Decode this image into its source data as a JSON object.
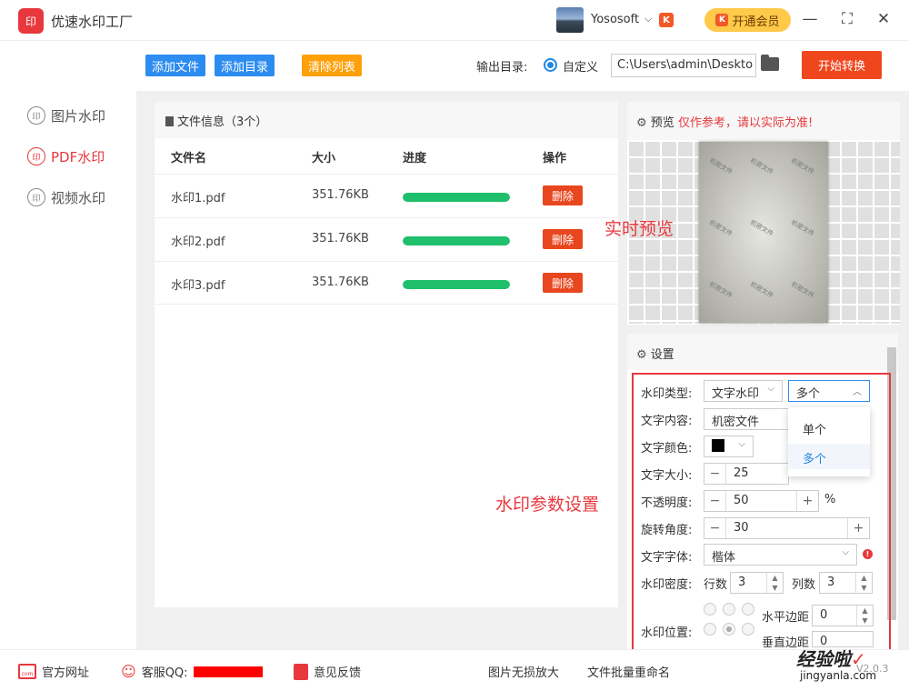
{
  "app": {
    "logo_text": "印",
    "title": "优速水印工厂"
  },
  "user": {
    "name": "Yososoft",
    "chevron": "⌵",
    "badge": "K"
  },
  "vip": {
    "label": "开通会员",
    "icon": "K"
  },
  "window": {
    "minimize": "—",
    "maximize": "⛶",
    "close": "✕"
  },
  "sidebar": {
    "items": [
      {
        "icon": "印",
        "label": "图片水印"
      },
      {
        "icon": "印",
        "label": "PDF水印"
      },
      {
        "icon": "印",
        "label": "视频水印"
      }
    ]
  },
  "toolbar": {
    "add_file": "添加文件",
    "add_dir": "添加目录",
    "clear": "清除列表",
    "output_label": "输出目录:",
    "radio_label": "自定义",
    "output_path": "C:\\Users\\admin\\Deskto",
    "start": "开始转换"
  },
  "files": {
    "header": "文件信息（3个）",
    "columns": [
      "文件名",
      "大小",
      "进度",
      "操作"
    ],
    "rows": [
      {
        "name": "水印1.pdf",
        "size": "351.76KB",
        "progress": 1.0,
        "action": "删除"
      },
      {
        "name": "水印2.pdf",
        "size": "351.76KB",
        "progress": 1.0,
        "action": "删除"
      },
      {
        "name": "水印3.pdf",
        "size": "351.76KB",
        "progress": 1.0,
        "action": "删除"
      }
    ]
  },
  "preview": {
    "title": "预览",
    "warning": "仅作参考，请以实际为准!",
    "watermark_text": "机密文件"
  },
  "annotations": {
    "preview": "实时预览",
    "settings": "水印参数设置"
  },
  "settings": {
    "title": "设置",
    "type_label": "水印类型:",
    "type_value": "文字水印",
    "count_value": "多个",
    "count_options": [
      "单个",
      "多个"
    ],
    "text_label": "文字内容:",
    "text_value": "机密文件",
    "color_label": "文字颜色:",
    "color_value": "#000000",
    "size_label": "文字大小:",
    "size_value": "25",
    "opacity_label": "不透明度:",
    "opacity_value": "50",
    "opacity_unit": "%",
    "rotate_label": "旋转角度:",
    "rotate_value": "30",
    "font_label": "文字字体:",
    "font_value": "楷体",
    "density_label": "水印密度:",
    "rows_label": "行数",
    "rows_value": "3",
    "cols_label": "列数",
    "cols_value": "3",
    "position_label": "水印位置:",
    "hmargin_label": "水平边距",
    "hmargin_value": "0",
    "vmargin_label": "垂直边距",
    "vmargin_value": "0"
  },
  "footer": {
    "website": "官方网址",
    "qq": "客服QQ:",
    "feedback": "意见反馈",
    "link1": "图片无损放大",
    "link2": "文件批量重命名",
    "version": "V2.0.3"
  },
  "site_watermark": {
    "logo": "经验啦",
    "check": "✓",
    "url": "jingyanla.com"
  }
}
